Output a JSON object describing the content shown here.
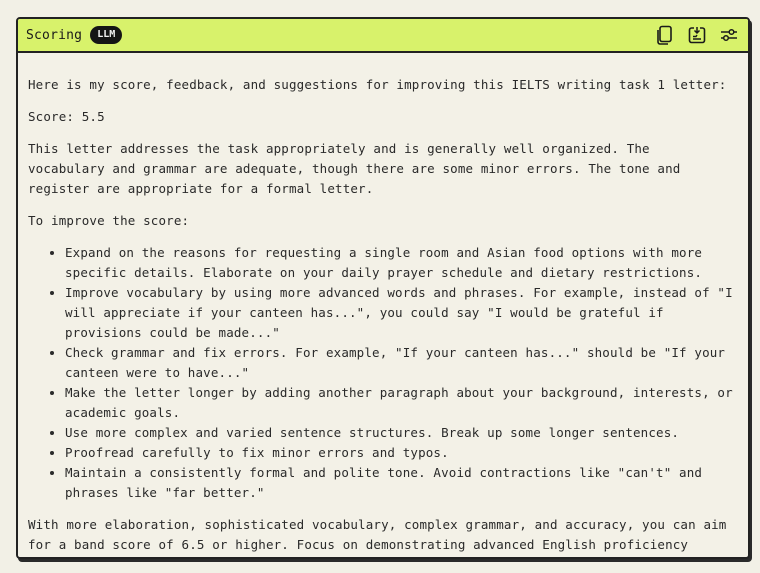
{
  "panel": {
    "title": "Scoring",
    "badge": "LLM",
    "icons": [
      "copy-icon",
      "export-icon",
      "settings-sliders-icon"
    ]
  },
  "content": {
    "intro": "Here is my score, feedback, and suggestions for improving this IELTS writing task 1 letter:",
    "score": "Score: 5.5",
    "summary": "This letter addresses the task appropriately and is generally well organized. The vocabulary and grammar are adequate, though there are some minor errors. The tone and register are appropriate for a formal letter.",
    "improve_heading": "To improve the score:",
    "suggestions": [
      "Expand on the reasons for requesting a single room and Asian food options with more specific details. Elaborate on your daily prayer schedule and dietary restrictions.",
      "Improve vocabulary by using more advanced words and phrases. For example, instead of \"I will appreciate if your canteen has...\", you could say \"I would be grateful if provisions could be made...\"",
      "Check grammar and fix errors. For example, \"If your canteen has...\" should be \"If your canteen were to have...\"",
      "Make the letter longer by adding another paragraph about your background, interests, or academic goals.",
      "Use more complex and varied sentence structures. Break up some longer sentences.",
      "Proofread carefully to fix minor errors and typos.",
      "Maintain a consistently formal and polite tone. Avoid contractions like \"can't\" and phrases like \"far better.\""
    ],
    "conclusion": "With more elaboration, sophisticated vocabulary, complex grammar, and accuracy, you can aim for a band score of 6.5 or higher. Focus on demonstrating advanced English proficiency"
  }
}
